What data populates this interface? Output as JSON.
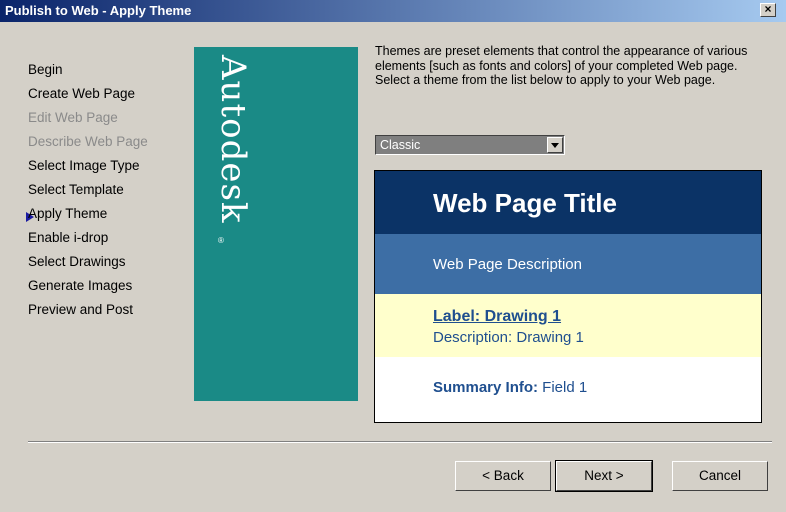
{
  "window": {
    "title": "Publish to Web - Apply Theme",
    "close_label": "×"
  },
  "steps": [
    {
      "label": "Begin",
      "disabled": false
    },
    {
      "label": "Create Web Page",
      "disabled": false
    },
    {
      "label": "Edit Web Page",
      "disabled": true
    },
    {
      "label": "Describe Web Page",
      "disabled": true
    },
    {
      "label": "Select Image Type",
      "disabled": false
    },
    {
      "label": "Select Template",
      "disabled": false
    },
    {
      "label": "Apply Theme",
      "disabled": false,
      "current": true
    },
    {
      "label": "Enable i-drop",
      "disabled": false
    },
    {
      "label": "Select Drawings",
      "disabled": false
    },
    {
      "label": "Generate Images",
      "disabled": false
    },
    {
      "label": "Preview and Post",
      "disabled": false
    }
  ],
  "brand": {
    "name": "Autodesk",
    "reg": "®",
    "color": "#1a8a86"
  },
  "main": {
    "description": "Themes are preset elements that control the appearance of various elements [such as fonts and colors] of your completed Web page.  Select a theme from the list below to apply to your Web page.",
    "theme_select": {
      "selected": "Classic"
    }
  },
  "preview": {
    "title": "Web Page Title",
    "description": "Web Page Description",
    "drawing_label": "Label: Drawing 1",
    "drawing_description": "Description: Drawing 1",
    "summary_label": "Summary Info:",
    "summary_value": " Field 1",
    "colors": {
      "title_bg": "#0b3366",
      "desc_bg": "#3d6ea5",
      "drawing_bg": "#ffffcc",
      "text": "#1f4f8f"
    }
  },
  "buttons": {
    "back": "< Back",
    "next": "Next >",
    "cancel": "Cancel"
  }
}
